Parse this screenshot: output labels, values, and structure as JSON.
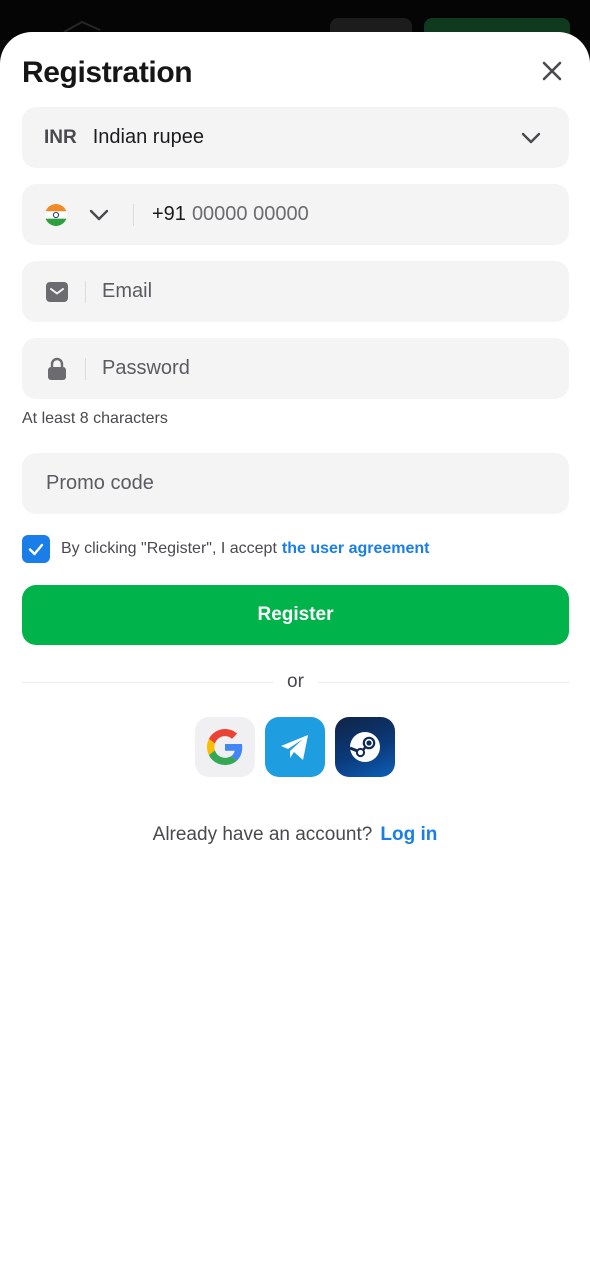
{
  "header": {
    "title": "Registration",
    "close_icon": "close-icon"
  },
  "currency": {
    "code": "INR",
    "name": "Indian rupee",
    "icon": "chevron-down-icon"
  },
  "phone": {
    "flag_icon": "india-flag-icon",
    "code": "+91",
    "placeholder": "00000 00000"
  },
  "email": {
    "icon": "envelope-icon",
    "placeholder": "Email"
  },
  "password": {
    "icon": "lock-icon",
    "placeholder": "Password",
    "hint": "At least 8 characters"
  },
  "promo": {
    "placeholder": "Promo code"
  },
  "agreement": {
    "checked": true,
    "text": "By clicking \"Register\", I accept",
    "link": "the user agreement"
  },
  "register_button": {
    "label": "Register"
  },
  "divider": {
    "text": "or"
  },
  "social": [
    {
      "name": "google-icon",
      "color": "#f0f0f2"
    },
    {
      "name": "telegram-icon",
      "color": "#1e9ee0"
    },
    {
      "name": "steam-icon",
      "color": "#0b3a7a"
    }
  ],
  "footer": {
    "question": "Already have an account?",
    "login_link": "Log in"
  },
  "colors": {
    "accent": "#1a7ee8",
    "primary_button": "#00b34a",
    "field_bg": "#f4f4f5"
  }
}
